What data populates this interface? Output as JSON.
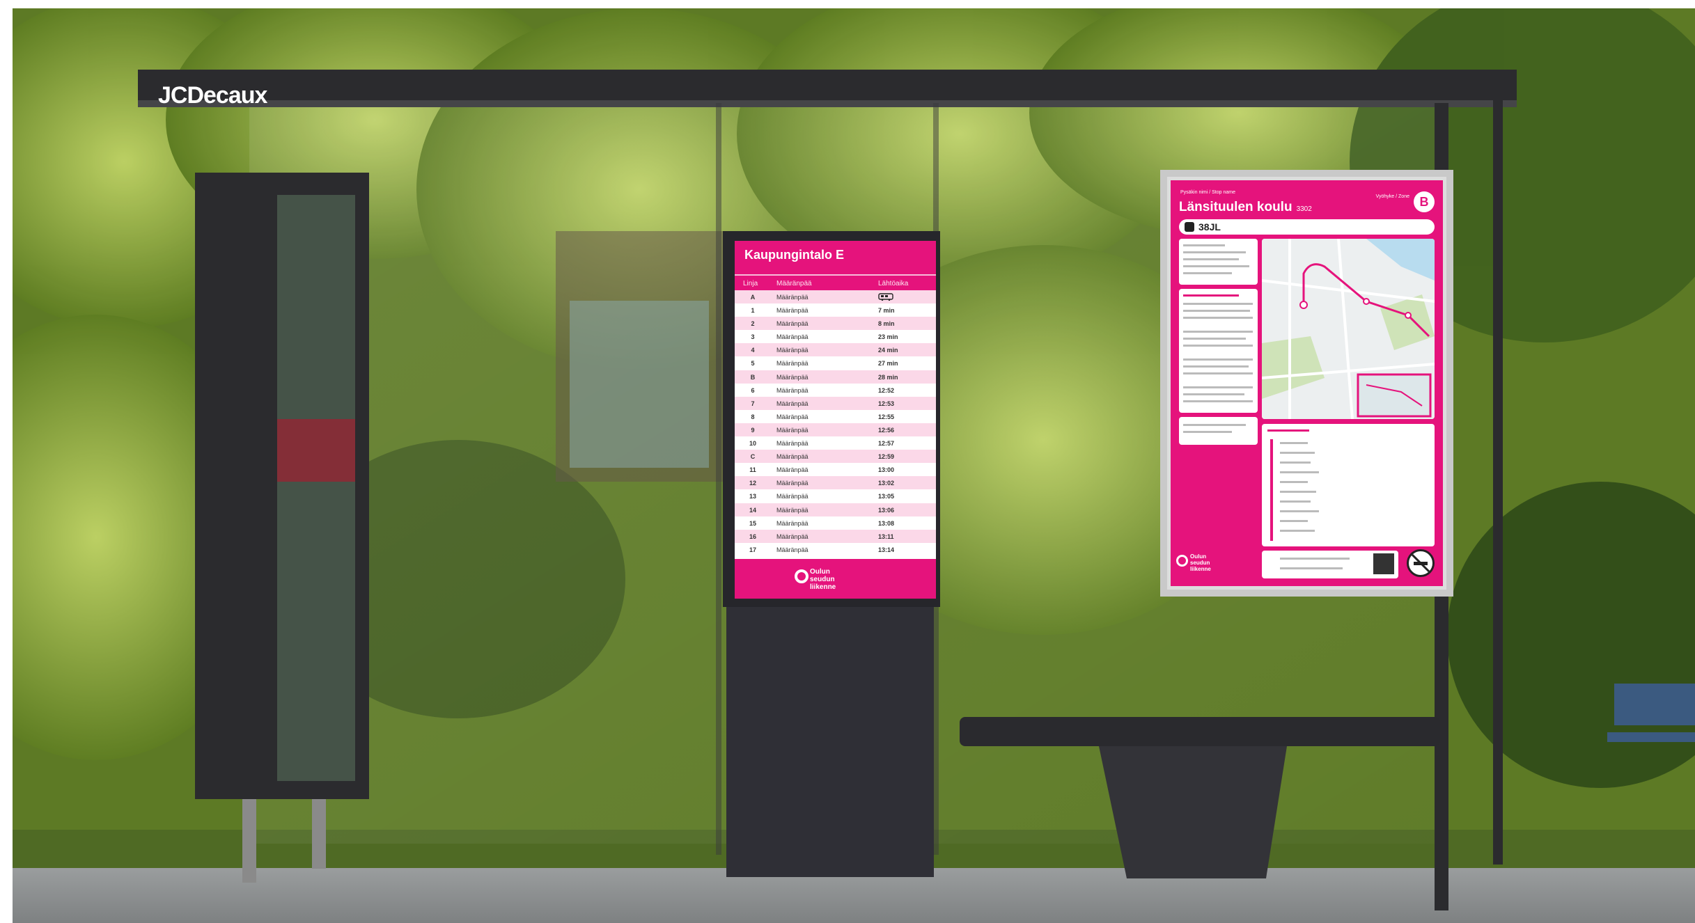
{
  "brand": {
    "name": "JCDecaux"
  },
  "display": {
    "title": "Kaupungintalo E",
    "headers": {
      "line": "Linja",
      "destination": "Määränpää",
      "departure": "Lähtöaika"
    },
    "rows": [
      {
        "line": "A",
        "destination": "Määränpää",
        "time": ""
      },
      {
        "line": "1",
        "destination": "Määränpää",
        "time": "7 min"
      },
      {
        "line": "2",
        "destination": "Määränpää",
        "time": "8 min"
      },
      {
        "line": "3",
        "destination": "Määränpää",
        "time": "23 min"
      },
      {
        "line": "4",
        "destination": "Määränpää",
        "time": "24 min"
      },
      {
        "line": "5",
        "destination": "Määränpää",
        "time": "27 min"
      },
      {
        "line": "B",
        "destination": "Määränpää",
        "time": "28 min"
      },
      {
        "line": "6",
        "destination": "Määränpää",
        "time": "12:52"
      },
      {
        "line": "7",
        "destination": "Määränpää",
        "time": "12:53"
      },
      {
        "line": "8",
        "destination": "Määränpää",
        "time": "12:55"
      },
      {
        "line": "9",
        "destination": "Määränpää",
        "time": "12:56"
      },
      {
        "line": "10",
        "destination": "Määränpää",
        "time": "12:57"
      },
      {
        "line": "C",
        "destination": "Määränpää",
        "time": "12:59"
      },
      {
        "line": "11",
        "destination": "Määränpää",
        "time": "13:00"
      },
      {
        "line": "12",
        "destination": "Määränpää",
        "time": "13:02"
      },
      {
        "line": "13",
        "destination": "Määränpää",
        "time": "13:05"
      },
      {
        "line": "14",
        "destination": "Määränpää",
        "time": "13:06"
      },
      {
        "line": "15",
        "destination": "Määränpää",
        "time": "13:08"
      },
      {
        "line": "16",
        "destination": "Määränpää",
        "time": "13:11"
      },
      {
        "line": "17",
        "destination": "Määränpää",
        "time": "13:14"
      }
    ],
    "logo": {
      "line1": "Oulun",
      "line2": "seudun",
      "line3": "liikenne"
    }
  },
  "poster": {
    "stop_label": "Pysäkin nimi / Stop name",
    "stop_name": "Länsituulen koulu",
    "stop_id": "3302",
    "zone_label": "Vyöhyke / Zone",
    "zone": "B",
    "route": "38JL",
    "logo": {
      "line1": "Oulun",
      "line2": "seudun",
      "line3": "liikenne"
    }
  },
  "colors": {
    "accent": "#e5137c",
    "foliage": "#6f8f2a",
    "shelter_frame": "#2b2b2e",
    "pavement": "#8c8f90"
  }
}
